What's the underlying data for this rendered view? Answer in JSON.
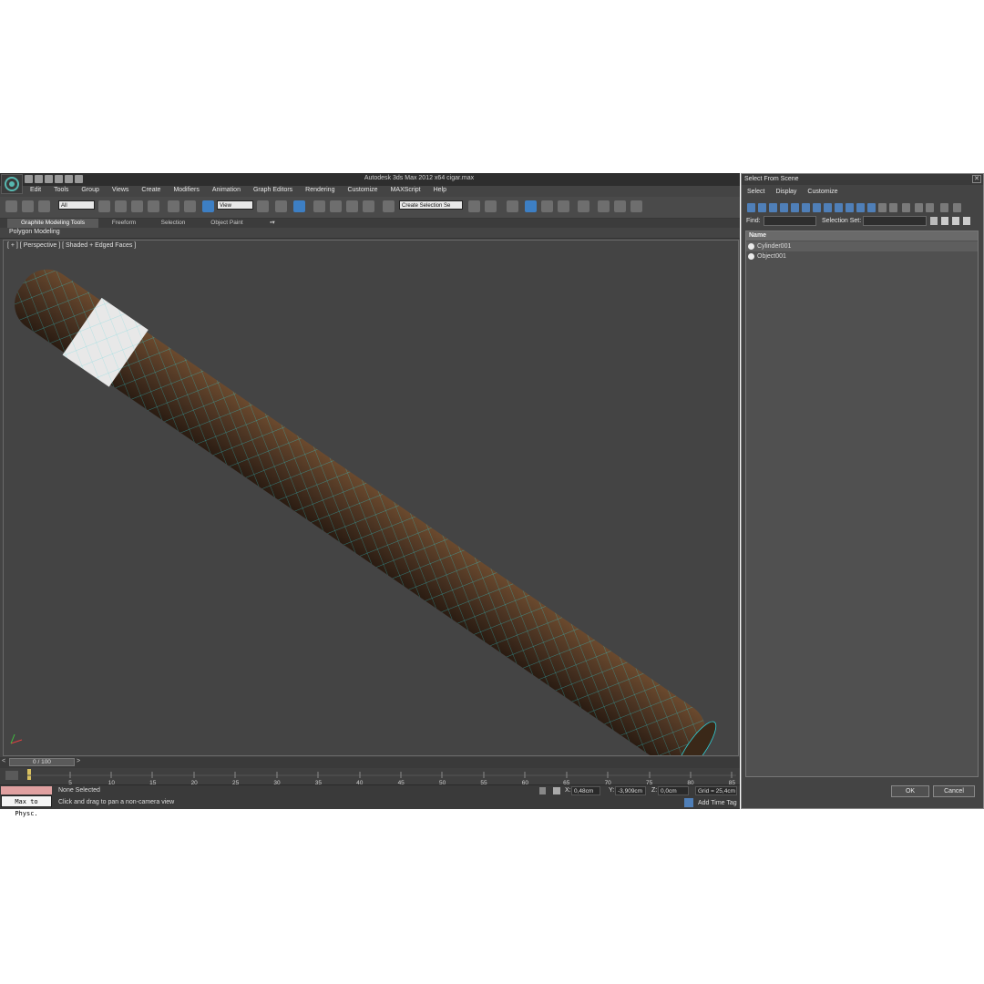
{
  "window": {
    "title": "Autodesk 3ds Max  2012 x64      cigar.max"
  },
  "menu": [
    "Edit",
    "Tools",
    "Group",
    "Views",
    "Create",
    "Modifiers",
    "Animation",
    "Graph Editors",
    "Rendering",
    "Customize",
    "MAXScript",
    "Help"
  ],
  "toolbar": {
    "filter_value": "All",
    "ref_coord_value": "View",
    "named_selection_value": "Create Selection Se"
  },
  "ribbon": {
    "tabs": [
      "Graphite Modeling Tools",
      "Freeform",
      "Selection",
      "Object Paint"
    ],
    "active_panel": "Polygon Modeling"
  },
  "viewport": {
    "label": "[ + ] [ Perspective ] [ Shaded + Edged Faces ]",
    "model_colors": {
      "body": "#4a3322",
      "wire": "#2fd0d8",
      "band": "#e8e8e8"
    }
  },
  "timeline": {
    "frame": "0 / 100",
    "ticks": [
      "5",
      "10",
      "15",
      "20",
      "25",
      "30",
      "35",
      "40",
      "45",
      "50",
      "55",
      "60",
      "65",
      "70",
      "75",
      "80",
      "85"
    ]
  },
  "status": {
    "maxscript_listener": "Max to Physc.",
    "selection": "None Selected",
    "prompt": "Click and drag to pan a non-camera view",
    "x_label": "X:",
    "x_value": "0,48cm",
    "y_label": "Y:",
    "y_value": "-3,909cm",
    "z_label": "Z:",
    "z_value": "0,0cm",
    "grid": "Grid = 25,4cm",
    "add_time_tag": "Add Time Tag"
  },
  "dialog": {
    "title": "Select From Scene",
    "menu": [
      "Select",
      "Display",
      "Customize"
    ],
    "find_label": "Find:",
    "selection_set_label": "Selection Set:",
    "column_name": "Name",
    "items": [
      "Cylinder001",
      "Object001"
    ],
    "ok": "OK",
    "cancel": "Cancel"
  }
}
